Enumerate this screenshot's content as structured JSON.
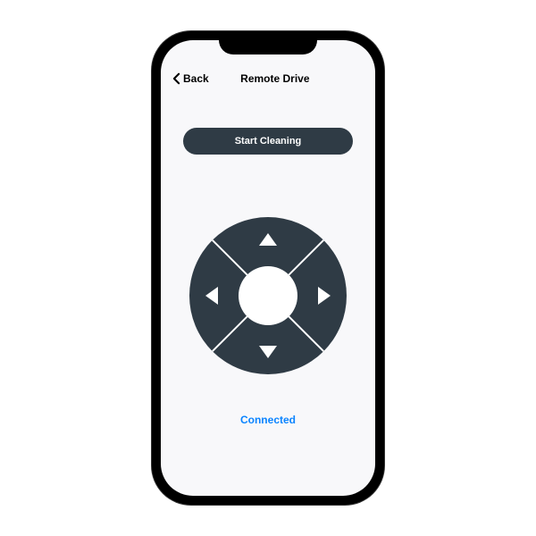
{
  "header": {
    "back_label": "Back",
    "title": "Remote Drive"
  },
  "actions": {
    "start_cleaning": "Start Cleaning"
  },
  "dpad": {
    "up": "up",
    "down": "down",
    "left": "left",
    "right": "right",
    "center": "center"
  },
  "status": {
    "text": "Connected",
    "color": "#0a84ff"
  },
  "colors": {
    "accent_dark": "#2f3b45",
    "screen_bg": "#f8f8fa"
  }
}
